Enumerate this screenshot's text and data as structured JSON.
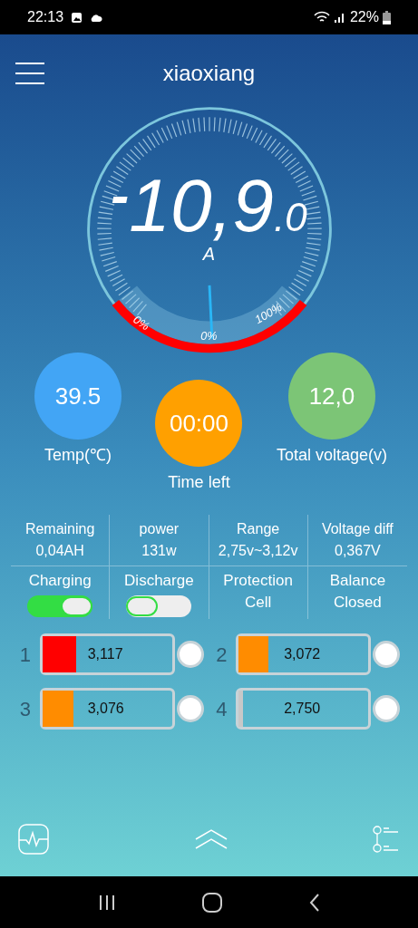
{
  "status_bar": {
    "time": "22:13",
    "battery": "22%"
  },
  "header": {
    "title": "xiaoxiang"
  },
  "gauge": {
    "sign": "-",
    "value": "10,9",
    "decimal": ".0",
    "unit": "A",
    "left_label": "0%",
    "center_label": "0%",
    "right_label": "100%"
  },
  "stats": [
    {
      "value": "39.5",
      "label": "Temp(℃)",
      "color": "#42a5f5"
    },
    {
      "value": "00:00",
      "label": "Time left",
      "color": "#ffa000"
    },
    {
      "value": "12,0",
      "label": "Total voltage(v)",
      "color": "#7cc576"
    }
  ],
  "info": [
    {
      "label": "Remaining",
      "value": "0,04AH"
    },
    {
      "label": "power",
      "value": "131w"
    },
    {
      "label": "Range",
      "value": "2,75v~3,12v"
    },
    {
      "label": "Voltage diff",
      "value": "0,367V"
    }
  ],
  "controls": [
    {
      "kind": "switch",
      "label": "Charging",
      "on": true
    },
    {
      "kind": "switch",
      "label": "Discharge",
      "on": false
    },
    {
      "kind": "text",
      "label": "Protection",
      "value": "Cell"
    },
    {
      "kind": "text",
      "label": "Balance",
      "value": "Closed"
    }
  ],
  "cells": [
    {
      "index": "1",
      "voltage": "3,117",
      "level": 0.26,
      "color": "#ff0000",
      "balancing": false
    },
    {
      "index": "2",
      "voltage": "3,072",
      "level": 0.23,
      "color": "#ff8c00",
      "balancing": false
    },
    {
      "index": "3",
      "voltage": "3,076",
      "level": 0.24,
      "color": "#ff8c00",
      "balancing": false
    },
    {
      "index": "4",
      "voltage": "2,750",
      "level": 0.02,
      "color": "#c8c8c8",
      "balancing": false
    }
  ]
}
